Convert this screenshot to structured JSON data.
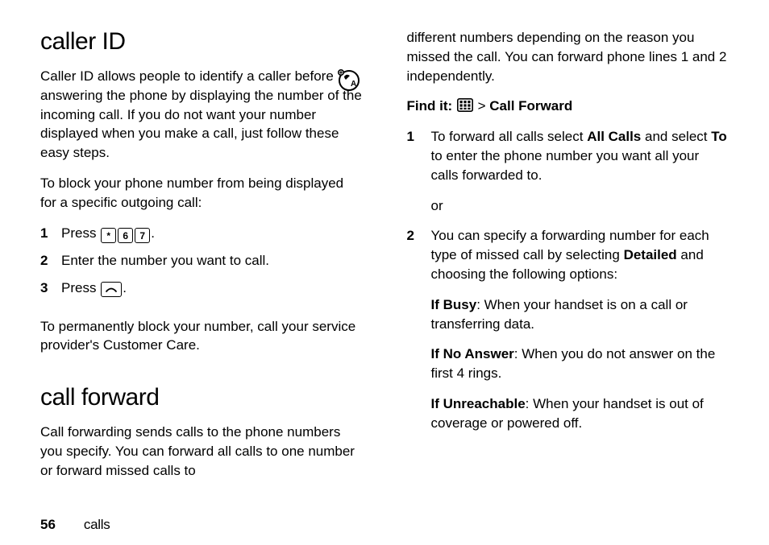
{
  "footer": {
    "page": "56",
    "section": "calls"
  },
  "left": {
    "h_callerid": "caller ID",
    "p_intro": "Caller ID allows people to identify a caller before answering the phone by displaying the number of the incoming call. If you do not want your number displayed when you make a call, just follow these easy steps.",
    "p_block": "To block your phone number from being displayed for a specific outgoing call:",
    "step1_press": "Press ",
    "step1_dot": ".",
    "key_star": "*",
    "key_6": "6",
    "key_7": "7",
    "step2": "Enter the number you want to call.",
    "step3_press": "Press ",
    "step3_dot": ".",
    "key_send_glyph": "⏑",
    "p_perm": "To permanently block your number, call your service provider's Customer Care.",
    "h_callfwd": "call forward",
    "p_fwd": "Call forwarding sends calls to the phone numbers you specify. You can forward all calls to one number or forward missed calls to"
  },
  "right": {
    "p_cont": "different numbers depending on the reason you missed the call. You can forward phone lines 1 and 2 independently.",
    "findit_label": "Find it:",
    "findit_gt": " > ",
    "findit_item": "Call Forward",
    "s1_a": "To forward all calls select ",
    "s1_allcalls": "All Calls",
    "s1_b": " and select ",
    "s1_to": "To",
    "s1_c": " to enter the phone number you want all your calls forwarded to.",
    "s1_or": "or",
    "s2_a": "You can specify a forwarding number for each type of missed call by selecting ",
    "s2_detailed": "Detailed",
    "s2_b": " and choosing the following options:",
    "ifbusy_l": "If Busy",
    "ifbusy_t": ": When your handset is on a call or transferring data.",
    "ifnoans_l": "If No Answer",
    "ifnoans_t": ": When you do not answer on the first 4 rings.",
    "ifunr_l": "If Unreachable",
    "ifunr_t": ": When your handset is out of coverage or powered off."
  }
}
